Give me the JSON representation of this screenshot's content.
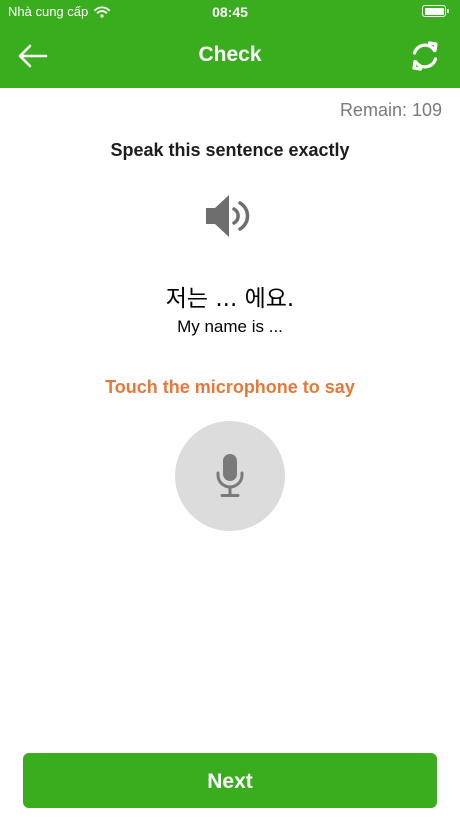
{
  "status_bar": {
    "carrier": "Nhà cung cấp",
    "time": "08:45"
  },
  "nav": {
    "title": "Check"
  },
  "remain": "Remain: 109",
  "instruction": "Speak this sentence exactly",
  "sentence": {
    "korean": "저는 ... 에요.",
    "translation": "My name is ..."
  },
  "hint": "Touch the microphone to say",
  "next_label": "Next",
  "icons": {
    "back": "arrow-left-icon",
    "refresh": "refresh-icon",
    "speaker": "speaker-icon",
    "microphone": "microphone-icon",
    "wifi": "wifi-icon",
    "battery": "battery-icon"
  },
  "colors": {
    "brand_green": "#3aad1f",
    "hint_orange": "#e8783a",
    "mic_bg": "#dcdcdc"
  }
}
